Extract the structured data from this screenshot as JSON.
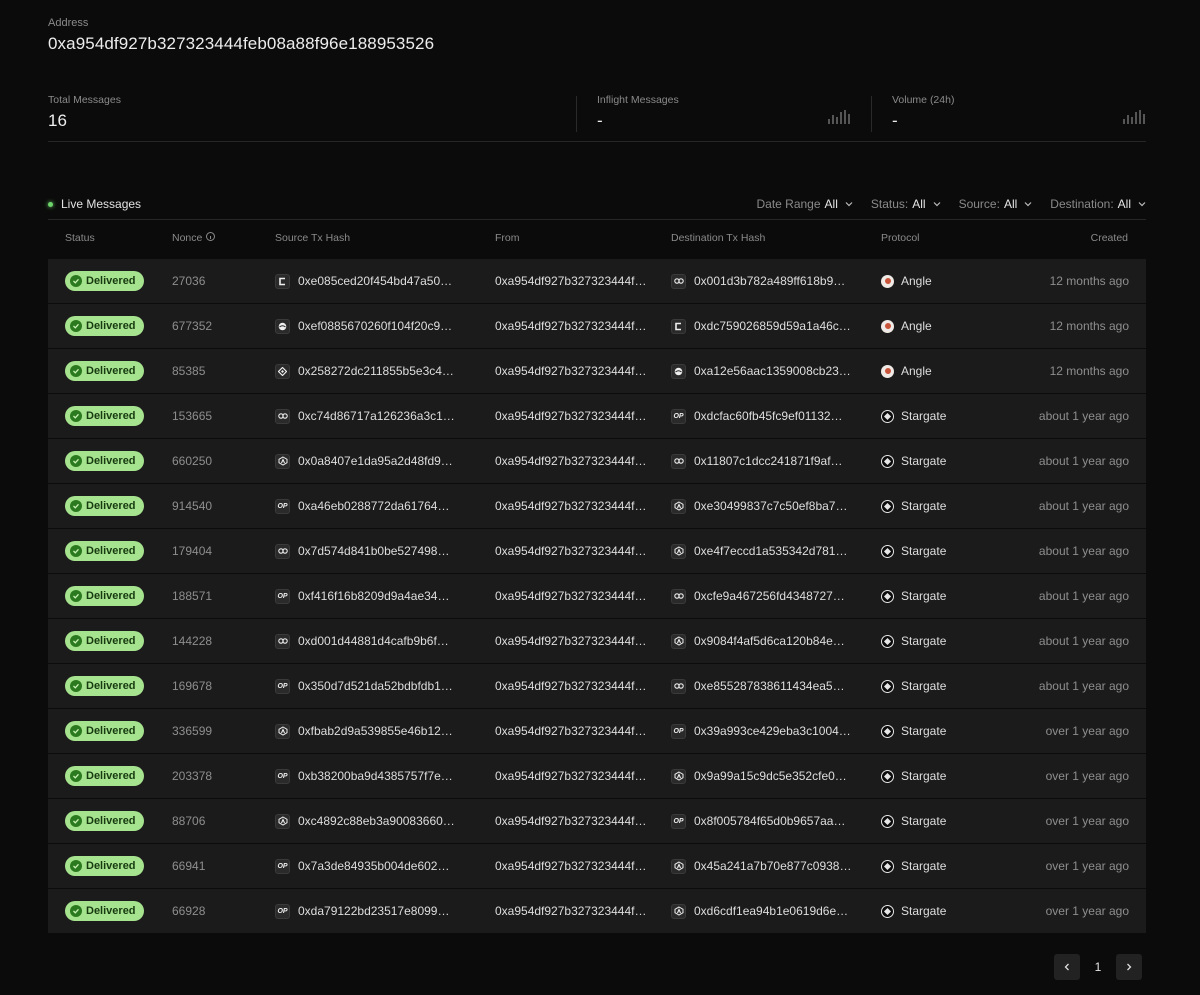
{
  "address": {
    "label": "Address",
    "value": "0xa954df927b327323444feb08a88f96e188953526"
  },
  "stats": [
    {
      "label": "Total Messages",
      "value": "16"
    },
    {
      "label": "Inflight Messages",
      "value": "-"
    },
    {
      "label": "Volume (24h)",
      "value": "-"
    }
  ],
  "live": {
    "label": "Live Messages",
    "indicator_color": "#6fd36b"
  },
  "filters": [
    {
      "label": "Date Range",
      "value": "All"
    },
    {
      "label": "Status:",
      "value": "All"
    },
    {
      "label": "Source:",
      "value": "All"
    },
    {
      "label": "Destination:",
      "value": "All"
    }
  ],
  "columns": {
    "status": "Status",
    "nonce": "Nonce",
    "source_tx": "Source Tx Hash",
    "from": "From",
    "dest_tx": "Destination Tx Hash",
    "protocol": "Protocol",
    "created": "Created"
  },
  "rows": [
    {
      "status": "Delivered",
      "nonce": "27036",
      "src_chain": "chain-c-icon",
      "src_tag": "",
      "source_tx": "0xe085ced20f454bd47a50…",
      "from": "0xa954df927b327323444f…",
      "dst_chain": "link-icon",
      "dst_tag": "",
      "dest_tx": "0x001d3b782a489ff618b9…",
      "protocol_icon": "angle",
      "protocol": "Angle",
      "created": "12 months ago"
    },
    {
      "status": "Delivered",
      "nonce": "677352",
      "src_chain": "globe-icon",
      "src_tag": "",
      "source_tx": "0xef0885670260f104f20c9…",
      "from": "0xa954df927b327323444f…",
      "dst_chain": "chain-c-icon",
      "dst_tag": "",
      "dest_tx": "0xdc759026859d59a1a46c…",
      "protocol_icon": "angle",
      "protocol": "Angle",
      "created": "12 months ago"
    },
    {
      "status": "Delivered",
      "nonce": "85385",
      "src_chain": "diamond-icon",
      "src_tag": "",
      "source_tx": "0x258272dc211855b5e3c4…",
      "from": "0xa954df927b327323444f…",
      "dst_chain": "globe-icon",
      "dst_tag": "",
      "dest_tx": "0xa12e56aac1359008cb23…",
      "protocol_icon": "angle",
      "protocol": "Angle",
      "created": "12 months ago"
    },
    {
      "status": "Delivered",
      "nonce": "153665",
      "src_chain": "link-icon",
      "src_tag": "",
      "source_tx": "0xc74d86717a126236a3c1…",
      "from": "0xa954df927b327323444f…",
      "dst_chain": "op-icon",
      "dst_tag": "OP",
      "dest_tx": "0xdcfac60fb45fc9ef01132…",
      "protocol_icon": "stargate",
      "protocol": "Stargate",
      "created": "about 1 year ago"
    },
    {
      "status": "Delivered",
      "nonce": "660250",
      "src_chain": "arbitrum-icon",
      "src_tag": "",
      "source_tx": "0x0a8407e1da95a2d48fd9…",
      "from": "0xa954df927b327323444f…",
      "dst_chain": "link-icon",
      "dst_tag": "",
      "dest_tx": "0x11807c1dcc241871f9af…",
      "protocol_icon": "stargate",
      "protocol": "Stargate",
      "created": "about 1 year ago"
    },
    {
      "status": "Delivered",
      "nonce": "914540",
      "src_chain": "op-icon",
      "src_tag": "OP",
      "source_tx": "0xa46eb0288772da61764…",
      "from": "0xa954df927b327323444f…",
      "dst_chain": "arbitrum-icon",
      "dst_tag": "",
      "dest_tx": "0xe30499837c7c50ef8ba7…",
      "protocol_icon": "stargate",
      "protocol": "Stargate",
      "created": "about 1 year ago"
    },
    {
      "status": "Delivered",
      "nonce": "179404",
      "src_chain": "link-icon",
      "src_tag": "",
      "source_tx": "0x7d574d841b0be527498…",
      "from": "0xa954df927b327323444f…",
      "dst_chain": "arbitrum-icon",
      "dst_tag": "",
      "dest_tx": "0xe4f7eccd1a535342d781…",
      "protocol_icon": "stargate",
      "protocol": "Stargate",
      "created": "about 1 year ago"
    },
    {
      "status": "Delivered",
      "nonce": "188571",
      "src_chain": "op-icon",
      "src_tag": "OP",
      "source_tx": "0xf416f16b8209d9a4ae34…",
      "from": "0xa954df927b327323444f…",
      "dst_chain": "link-icon",
      "dst_tag": "",
      "dest_tx": "0xcfe9a467256fd4348727…",
      "protocol_icon": "stargate",
      "protocol": "Stargate",
      "created": "about 1 year ago"
    },
    {
      "status": "Delivered",
      "nonce": "144228",
      "src_chain": "link-icon",
      "src_tag": "",
      "source_tx": "0xd001d44881d4cafb9b6f…",
      "from": "0xa954df927b327323444f…",
      "dst_chain": "arbitrum-icon",
      "dst_tag": "",
      "dest_tx": "0x9084f4af5d6ca120b84e…",
      "protocol_icon": "stargate",
      "protocol": "Stargate",
      "created": "about 1 year ago"
    },
    {
      "status": "Delivered",
      "nonce": "169678",
      "src_chain": "op-icon",
      "src_tag": "OP",
      "source_tx": "0x350d7d521da52bdbfdb1…",
      "from": "0xa954df927b327323444f…",
      "dst_chain": "link-icon",
      "dst_tag": "",
      "dest_tx": "0xe855287838611434ea5…",
      "protocol_icon": "stargate",
      "protocol": "Stargate",
      "created": "about 1 year ago"
    },
    {
      "status": "Delivered",
      "nonce": "336599",
      "src_chain": "arbitrum-icon",
      "src_tag": "",
      "source_tx": "0xfbab2d9a539855e46b12…",
      "from": "0xa954df927b327323444f…",
      "dst_chain": "op-icon",
      "dst_tag": "OP",
      "dest_tx": "0x39a993ce429eba3c1004…",
      "protocol_icon": "stargate",
      "protocol": "Stargate",
      "created": "over 1 year ago"
    },
    {
      "status": "Delivered",
      "nonce": "203378",
      "src_chain": "op-icon",
      "src_tag": "OP",
      "source_tx": "0xb38200ba9d4385757f7e…",
      "from": "0xa954df927b327323444f…",
      "dst_chain": "arbitrum-icon",
      "dst_tag": "",
      "dest_tx": "0x9a99a15c9dc5e352cfe0…",
      "protocol_icon": "stargate",
      "protocol": "Stargate",
      "created": "over 1 year ago"
    },
    {
      "status": "Delivered",
      "nonce": "88706",
      "src_chain": "arbitrum-icon",
      "src_tag": "",
      "source_tx": "0xc4892c88eb3a90083660…",
      "from": "0xa954df927b327323444f…",
      "dst_chain": "op-icon",
      "dst_tag": "OP",
      "dest_tx": "0x8f005784f65d0b9657aa…",
      "protocol_icon": "stargate",
      "protocol": "Stargate",
      "created": "over 1 year ago"
    },
    {
      "status": "Delivered",
      "nonce": "66941",
      "src_chain": "op-icon",
      "src_tag": "OP",
      "source_tx": "0x7a3de84935b004de602…",
      "from": "0xa954df927b327323444f…",
      "dst_chain": "arbitrum-icon",
      "dst_tag": "",
      "dest_tx": "0x45a241a7b70e877c0938…",
      "protocol_icon": "stargate",
      "protocol": "Stargate",
      "created": "over 1 year ago"
    },
    {
      "status": "Delivered",
      "nonce": "66928",
      "src_chain": "op-icon",
      "src_tag": "OP",
      "source_tx": "0xda79122bd23517e8099…",
      "from": "0xa954df927b327323444f…",
      "dst_chain": "arbitrum-icon",
      "dst_tag": "",
      "dest_tx": "0xd6cdf1ea94b1e0619d6e…",
      "protocol_icon": "stargate",
      "protocol": "Stargate",
      "created": "over 1 year ago"
    }
  ],
  "pagination": {
    "current_page": "1"
  },
  "colors": {
    "background": "#0b0b0b",
    "row": "#1b1b1b",
    "badge": "#a6e38e"
  }
}
